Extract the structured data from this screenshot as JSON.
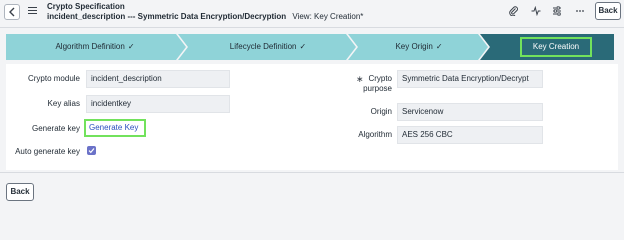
{
  "header": {
    "title": "Crypto Specification",
    "record": "incident_description --- Symmetric Data Encryption/Decryption",
    "view": "View: Key Creation*",
    "back_label": "Back"
  },
  "stages": [
    {
      "label": "Algorithm Definition",
      "check": "✓"
    },
    {
      "label": "Lifecycle Definition",
      "check": "✓"
    },
    {
      "label": "Key Origin",
      "check": "✓"
    },
    {
      "label": "Key Creation",
      "check": ""
    }
  ],
  "colors": {
    "stage_done": "#8fd3d8",
    "stage_active": "#2a6a78",
    "highlight": "#72e25c",
    "link": "#2a4dbf"
  },
  "form": {
    "crypto_module": {
      "label": "Crypto module",
      "value": "incident_description"
    },
    "key_alias": {
      "label": "Key alias",
      "value": "incidentkey"
    },
    "generate_key": {
      "label": "Generate key",
      "link": "Generate Key"
    },
    "auto_generate": {
      "label": "Auto generate key",
      "checked": true
    },
    "crypto_purpose": {
      "label_line1": "Crypto",
      "label_line2": "purpose",
      "required": "∗",
      "value": "Symmetric Data Encryption/Decrypt"
    },
    "origin": {
      "label": "Origin",
      "value": "Servicenow"
    },
    "algorithm": {
      "label": "Algorithm",
      "value": "AES 256 CBC"
    }
  },
  "footer": {
    "back_label": "Back"
  }
}
